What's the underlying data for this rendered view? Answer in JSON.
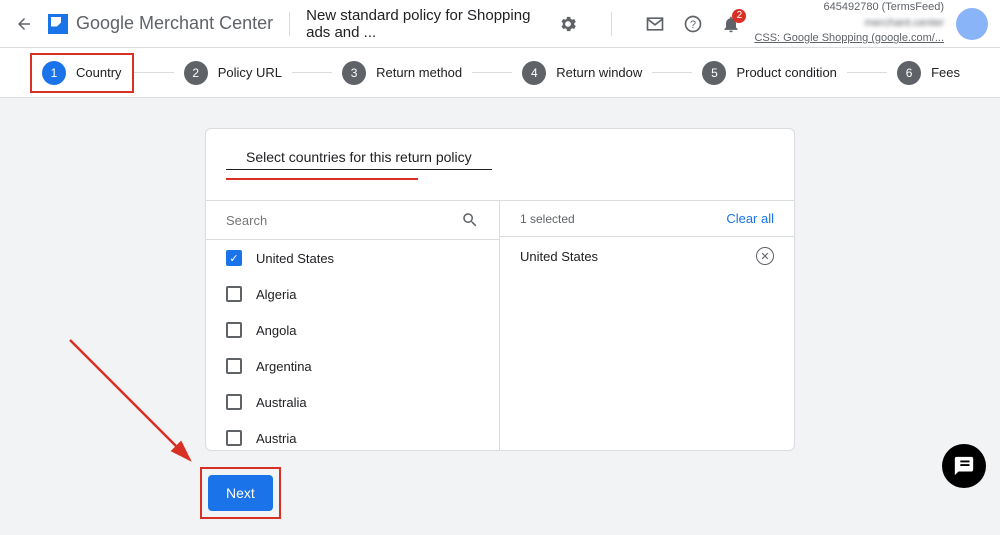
{
  "header": {
    "brand_bold": "Google",
    "brand_rest": " Merchant Center",
    "page_title": "New standard policy for Shopping ads and ...",
    "notification_count": "2",
    "account_id": "645492780 (TermsFeed)",
    "account_blur": "merchant.center",
    "css_line": "CSS: Google Shopping (google.com/..."
  },
  "stepper": [
    {
      "num": "1",
      "label": "Country",
      "active": true
    },
    {
      "num": "2",
      "label": "Policy URL",
      "active": false
    },
    {
      "num": "3",
      "label": "Return method",
      "active": false
    },
    {
      "num": "4",
      "label": "Return window",
      "active": false
    },
    {
      "num": "5",
      "label": "Product condition",
      "active": false
    },
    {
      "num": "6",
      "label": "Fees",
      "active": false
    }
  ],
  "card": {
    "title": "Select countries for this return policy",
    "search_placeholder": "Search",
    "selected_count": "1 selected",
    "clear_label": "Clear all",
    "countries": [
      {
        "name": "United States",
        "checked": true
      },
      {
        "name": "Algeria",
        "checked": false
      },
      {
        "name": "Angola",
        "checked": false
      },
      {
        "name": "Argentina",
        "checked": false
      },
      {
        "name": "Australia",
        "checked": false
      },
      {
        "name": "Austria",
        "checked": false
      }
    ],
    "selected": [
      {
        "name": "United States"
      }
    ]
  },
  "footer": {
    "next_label": "Next"
  }
}
